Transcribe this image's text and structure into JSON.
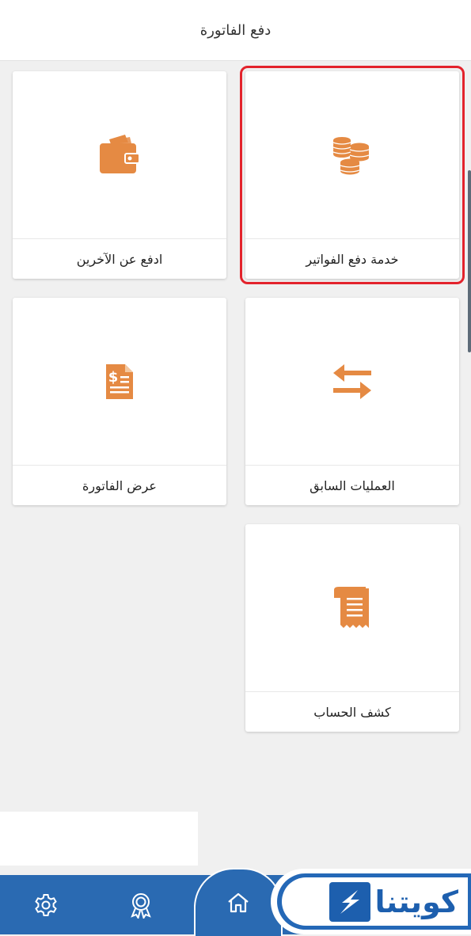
{
  "header": {
    "title": "دفع الفاتورة"
  },
  "cards": [
    {
      "label": "خدمة دفع الفواتير",
      "icon": "coins-icon",
      "selected": true
    },
    {
      "label": "ادفع عن الآخرين",
      "icon": "wallet-icon",
      "selected": false
    },
    {
      "label": "العمليات السابق",
      "icon": "transfer-arrows-icon",
      "selected": false
    },
    {
      "label": "عرض الفاتورة",
      "icon": "invoice-dollar-icon",
      "selected": false
    },
    {
      "label": "كشف الحساب",
      "icon": "receipt-scroll-icon",
      "selected": false
    }
  ],
  "bottom_nav": {
    "items": [
      "settings-icon",
      "award-icon",
      "home-icon"
    ]
  },
  "logo": {
    "text": "كويتنا"
  },
  "colors": {
    "accent": "#e58a43",
    "nav": "#2a6ab2",
    "highlight": "#e3232c",
    "logo": "#1d5fae"
  }
}
